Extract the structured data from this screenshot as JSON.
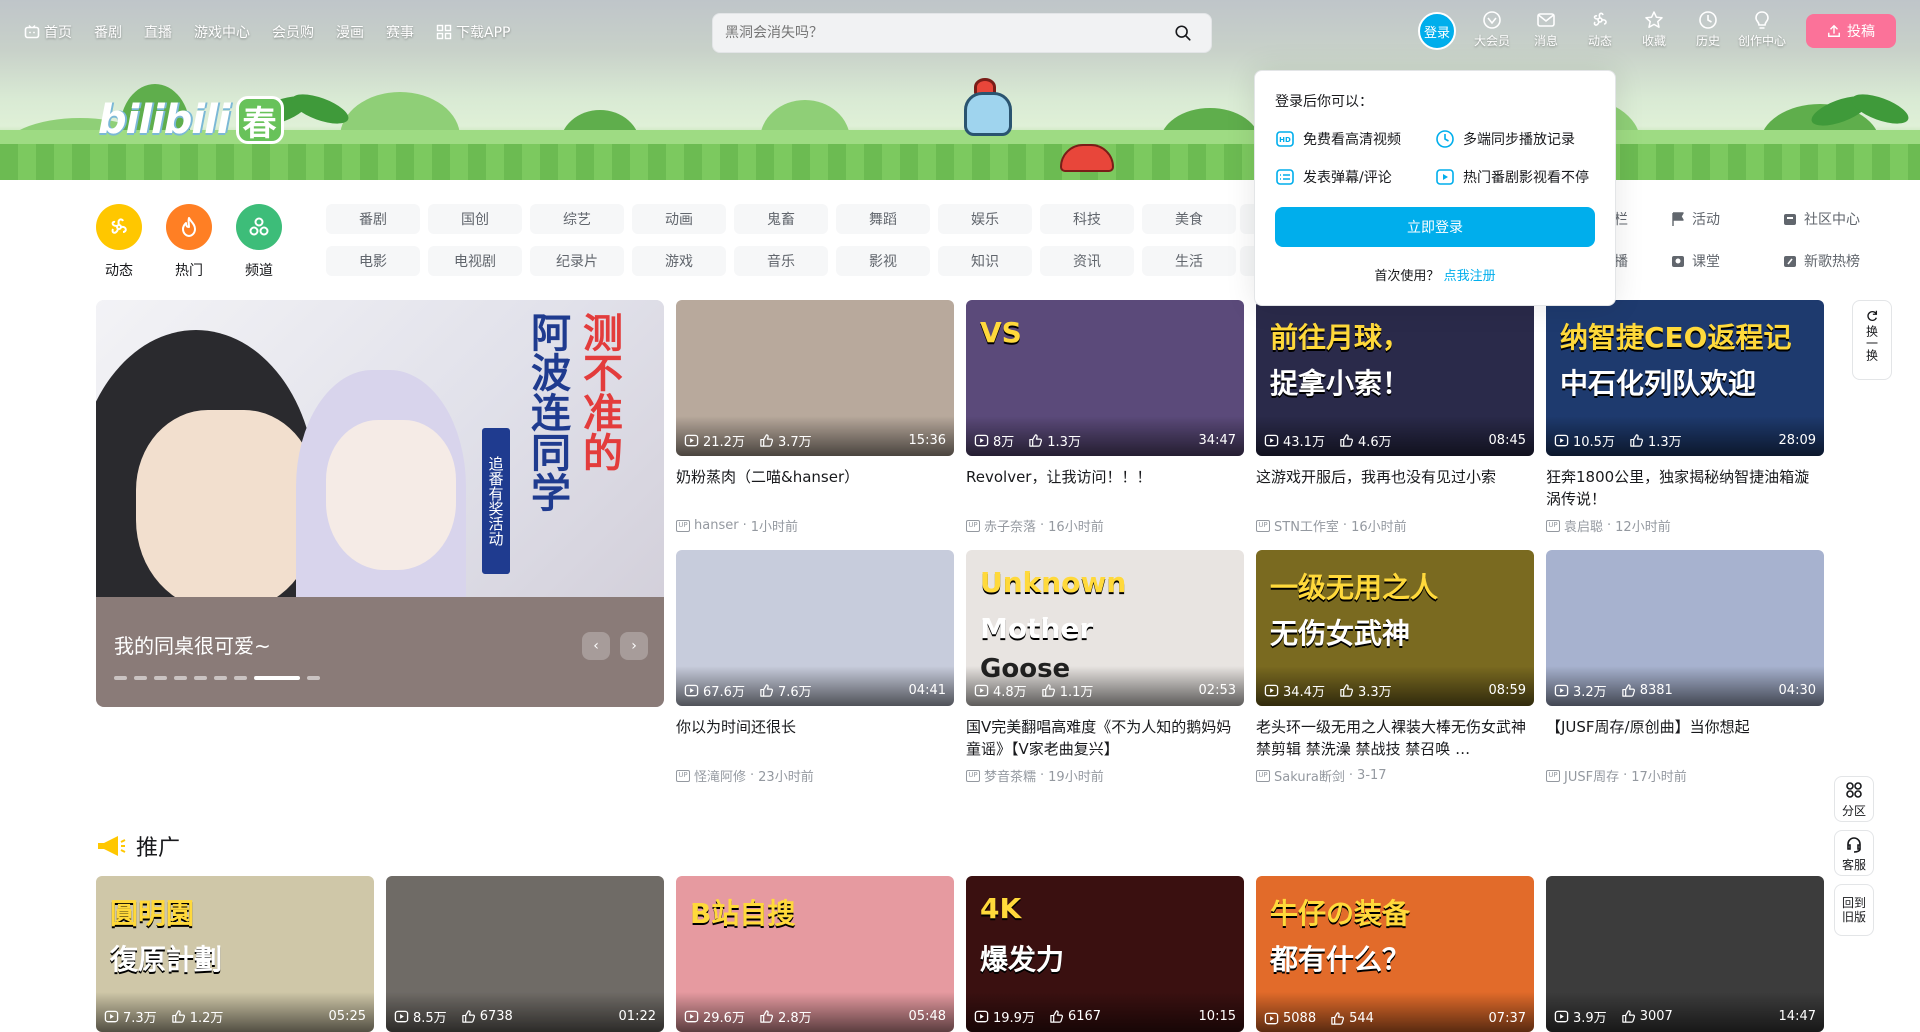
{
  "topnav": {
    "links": [
      {
        "label": "首页",
        "icon": "tv-icon"
      },
      {
        "label": "番剧"
      },
      {
        "label": "直播"
      },
      {
        "label": "游戏中心"
      },
      {
        "label": "会员购"
      },
      {
        "label": "漫画"
      },
      {
        "label": "赛事"
      },
      {
        "label": "下载APP",
        "icon": "app-grid-icon"
      }
    ],
    "search_placeholder": "黑洞会消失吗？",
    "login_label": "登录",
    "icons": [
      {
        "label": "大会员",
        "icon": "vip-icon"
      },
      {
        "label": "消息",
        "icon": "mail-icon"
      },
      {
        "label": "动态",
        "icon": "wind-icon"
      },
      {
        "label": "收藏",
        "icon": "star-icon"
      },
      {
        "label": "历史",
        "icon": "clock-icon"
      },
      {
        "label": "创作中心",
        "icon": "bulb-icon"
      }
    ],
    "upload_label": "投稿"
  },
  "banner": {
    "logo_text": "bilibili",
    "logo_badge": "春"
  },
  "login_popover": {
    "title": "登录后你可以：",
    "items": [
      {
        "label": "免费看高清视频",
        "icon": "hd-icon"
      },
      {
        "label": "多端同步播放记录",
        "icon": "clock-icon"
      },
      {
        "label": "发表弹幕/评论",
        "icon": "comment-icon"
      },
      {
        "label": "热门番剧影视看不停",
        "icon": "play-icon"
      }
    ],
    "login_button": "立即登录",
    "register_prompt": "首次使用？",
    "register_link": "点我注册"
  },
  "quick_entries": [
    {
      "label": "动态",
      "color": "#ffc700",
      "icon": "wind-icon"
    },
    {
      "label": "热门",
      "color": "#ff7f24",
      "icon": "fire-icon"
    },
    {
      "label": "频道",
      "color": "#3dbd79",
      "icon": "channel-icon"
    }
  ],
  "channels": {
    "row1": [
      "番剧",
      "国创",
      "综艺",
      "动画",
      "鬼畜",
      "舞蹈",
      "娱乐",
      "科技",
      "美食"
    ],
    "row2": [
      "电影",
      "电视剧",
      "纪录片",
      "游戏",
      "音乐",
      "影视",
      "知识",
      "资讯",
      "生活"
    ],
    "right": [
      {
        "label": "专栏",
        "icon": "article-icon"
      },
      {
        "label": "活动",
        "icon": "flag-icon"
      },
      {
        "label": "社区中心",
        "icon": "community-icon"
      },
      {
        "label": "直播",
        "icon": "live-icon"
      },
      {
        "label": "课堂",
        "icon": "class-icon"
      },
      {
        "label": "新歌热榜",
        "icon": "music-icon"
      }
    ]
  },
  "carousel": {
    "title": "我的同桌很可爱~",
    "art_text_red": "测不准的",
    "art_text_blue": "阿波连同学",
    "art_tag": "追番有奖活动",
    "dot_count": 9,
    "active_dot": 7
  },
  "videos": [
    {
      "title": "奶粉蒸肉（二喵&hanser）",
      "views": "21.2万",
      "likes": "3.7万",
      "duration": "15:36",
      "author": "hanser",
      "time": "1小时前",
      "color": "#b8a99c"
    },
    {
      "title": "Revolver，让我访问！！！",
      "views": "8万",
      "likes": "1.3万",
      "duration": "34:47",
      "author": "赤子奈落",
      "time": "16小时前",
      "color": "#5b4a7a",
      "overlay": "VS"
    },
    {
      "title": "这游戏开服后，我再也没有见过小索",
      "views": "43.1万",
      "likes": "4.6万",
      "duration": "08:45",
      "author": "STN工作室",
      "time": "16小时前",
      "color": "#2a2a4a",
      "overlay": "前往月球，",
      "overlay2": "捉拿小索！"
    },
    {
      "title": "狂奔1800公里，独家揭秘纳智捷油箱漩涡传说！",
      "views": "10.5万",
      "likes": "1.3万",
      "duration": "28:09",
      "author": "袁启聪",
      "time": "12小时前",
      "color": "#1e3a6e",
      "overlay": "纳智捷CEO返程记",
      "overlay2": "中石化列队欢迎"
    },
    {
      "title": "你以为时间还很长",
      "views": "67.6万",
      "likes": "7.6万",
      "duration": "04:41",
      "author": "怪滝阿修",
      "time": "23小时前",
      "color": "#c7ccdc"
    },
    {
      "title": "国V完美翻唱高难度《不为人知的鹅妈妈童谣》【V家老曲复兴】",
      "views": "4.8万",
      "likes": "1.1万",
      "duration": "02:53",
      "author": "梦音茶糯",
      "time": "19小时前",
      "color": "#e8e4e1",
      "overlay": "Unknown",
      "overlay2": "Mother",
      "overlay3": "Goose"
    },
    {
      "title": "老头环一级无用之人裸装大棒无伤女武神 禁剪辑 禁洗澡 禁战技 禁召唤 …",
      "views": "34.4万",
      "likes": "3.3万",
      "duration": "08:59",
      "author": "Sakura断剑",
      "time": "3-17",
      "color": "#7a6a20",
      "overlay": "一级无用之人",
      "overlay2": "无伤女武神"
    },
    {
      "title": "【JUSF周存/原创曲】当你想起",
      "views": "3.2万",
      "likes": "8381",
      "duration": "04:30",
      "author": "JUSF周存",
      "time": "17小时前",
      "color": "#a7b2cf"
    }
  ],
  "promo": {
    "title": "推广",
    "videos": [
      {
        "views": "7.3万",
        "likes": "1.2万",
        "duration": "05:25",
        "color": "#cfc7a8",
        "overlay": "圓明園",
        "overlay2": "復原計劃"
      },
      {
        "views": "8.5万",
        "likes": "6738",
        "duration": "01:22",
        "color": "#6f6b66"
      },
      {
        "views": "29.6万",
        "likes": "2.8万",
        "duration": "05:48",
        "color": "#e69aa0",
        "overlay": "B站自搜"
      },
      {
        "views": "19.9万",
        "likes": "6167",
        "duration": "10:15",
        "color": "#3a1010",
        "overlay": "4K",
        "overlay2": "爆发力"
      },
      {
        "views": "5088",
        "likes": "544",
        "duration": "07:37",
        "color": "#e26b2a",
        "overlay": "牛仔の装备",
        "overlay2": "都有什么？"
      },
      {
        "views": "3.9万",
        "likes": "3007",
        "duration": "14:47",
        "color": "#3c3c3c"
      }
    ]
  },
  "right_float": {
    "change_label": "换一换",
    "buttons": [
      {
        "label": "分区",
        "icon": "category-icon"
      },
      {
        "label": "客服",
        "icon": "headset-icon"
      },
      {
        "label": "回到旧版",
        "icon": ""
      }
    ]
  }
}
